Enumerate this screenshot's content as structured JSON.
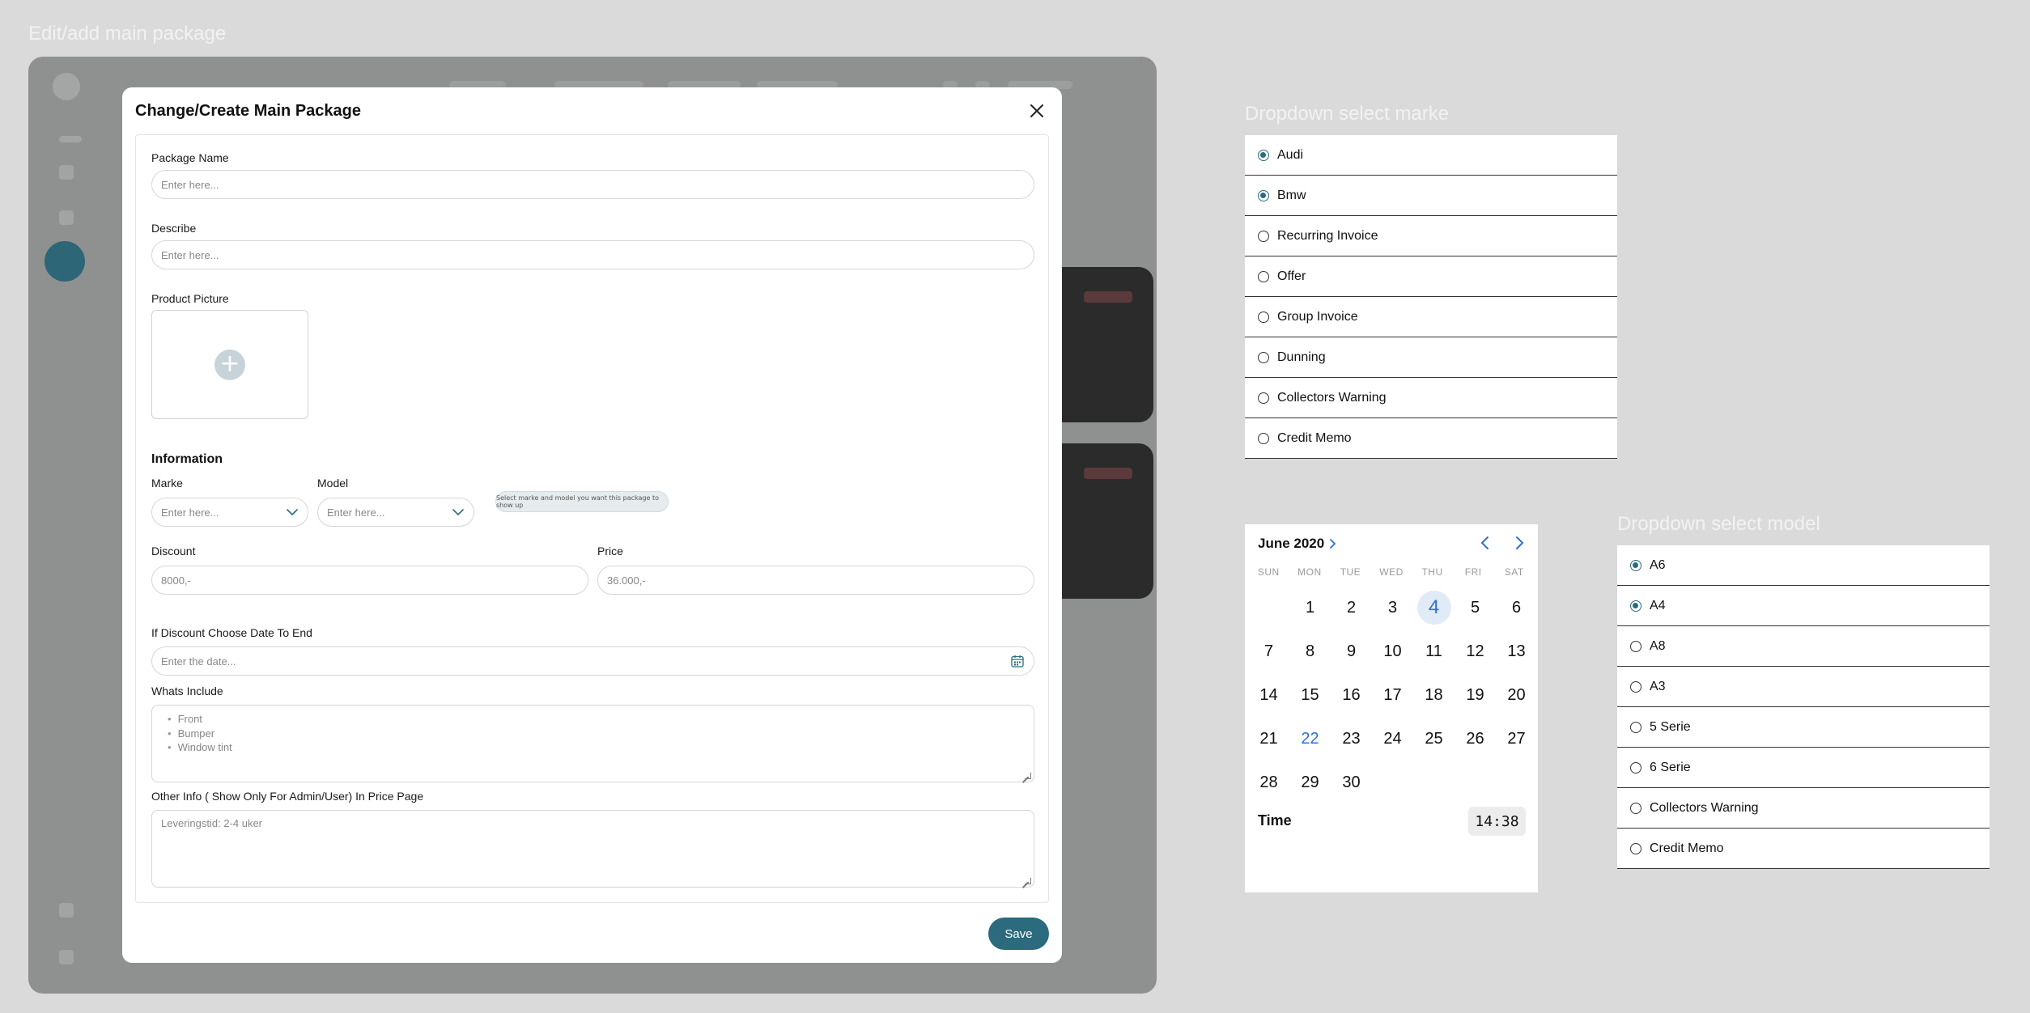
{
  "frames": {
    "edit_title": "Edit/add main package",
    "marke_title": "Dropdown select marke",
    "model_title": "Dropdown select model"
  },
  "modal": {
    "title": "Change/Create Main Package",
    "package_name_label": "Package Name",
    "package_name_placeholder": "Enter here...",
    "describe_label": "Describe",
    "describe_placeholder": "Enter here...",
    "product_picture_label": "Product Picture",
    "information_heading": "Information",
    "marke_label": "Marke",
    "marke_placeholder": "Enter here...",
    "model_label": "Model",
    "model_placeholder": "Enter here...",
    "hint": "Select marke and model you want this package to show up",
    "discount_label": "Discount",
    "discount_placeholder": "8000,-",
    "price_label": "Price",
    "price_placeholder": "36.000,-",
    "date_label": "If Discount Choose Date To End",
    "date_placeholder": "Enter the date...",
    "whats_include_label": "Whats Include",
    "whats_include_items": [
      "Front",
      "Bumper",
      "Window tint"
    ],
    "other_info_label": "Other Info ( Show Only For Admin/User) In Price Page",
    "other_info_placeholder": "Leveringstid: 2-4 uker",
    "save_label": "Save"
  },
  "marke_dropdown": {
    "items": [
      {
        "label": "Audi",
        "selected": true
      },
      {
        "label": "Bmw",
        "selected": true
      },
      {
        "label": "Recurring Invoice",
        "selected": false
      },
      {
        "label": "Offer",
        "selected": false
      },
      {
        "label": "Group Invoice",
        "selected": false
      },
      {
        "label": "Dunning",
        "selected": false
      },
      {
        "label": "Collectors Warning",
        "selected": false
      },
      {
        "label": "Credit Memo",
        "selected": false
      }
    ]
  },
  "model_dropdown": {
    "items": [
      {
        "label": "A6",
        "selected": true
      },
      {
        "label": "A4",
        "selected": true
      },
      {
        "label": "A8",
        "selected": false
      },
      {
        "label": "A3",
        "selected": false
      },
      {
        "label": "5 Serie",
        "selected": false
      },
      {
        "label": "6 Serie",
        "selected": false
      },
      {
        "label": "Collectors Warning",
        "selected": false
      },
      {
        "label": "Credit Memo",
        "selected": false
      }
    ]
  },
  "calendar": {
    "month": "June 2020",
    "weekdays": [
      "SUN",
      "MON",
      "TUE",
      "WED",
      "THU",
      "FRI",
      "SAT"
    ],
    "leading_blanks": 1,
    "days": [
      "1",
      "2",
      "3",
      "4",
      "5",
      "6",
      "7",
      "8",
      "9",
      "10",
      "11",
      "12",
      "13",
      "14",
      "15",
      "16",
      "17",
      "18",
      "19",
      "20",
      "21",
      "22",
      "23",
      "24",
      "25",
      "26",
      "27",
      "28",
      "29",
      "30"
    ],
    "selected_day": "4",
    "today_day": "22",
    "time_label": "Time",
    "time_value": "14:38"
  },
  "colors": {
    "accent": "#2b6b7d",
    "calendar_blue": "#2f6fd4",
    "backdrop": "#8f9190",
    "page_bg": "#dadada"
  }
}
